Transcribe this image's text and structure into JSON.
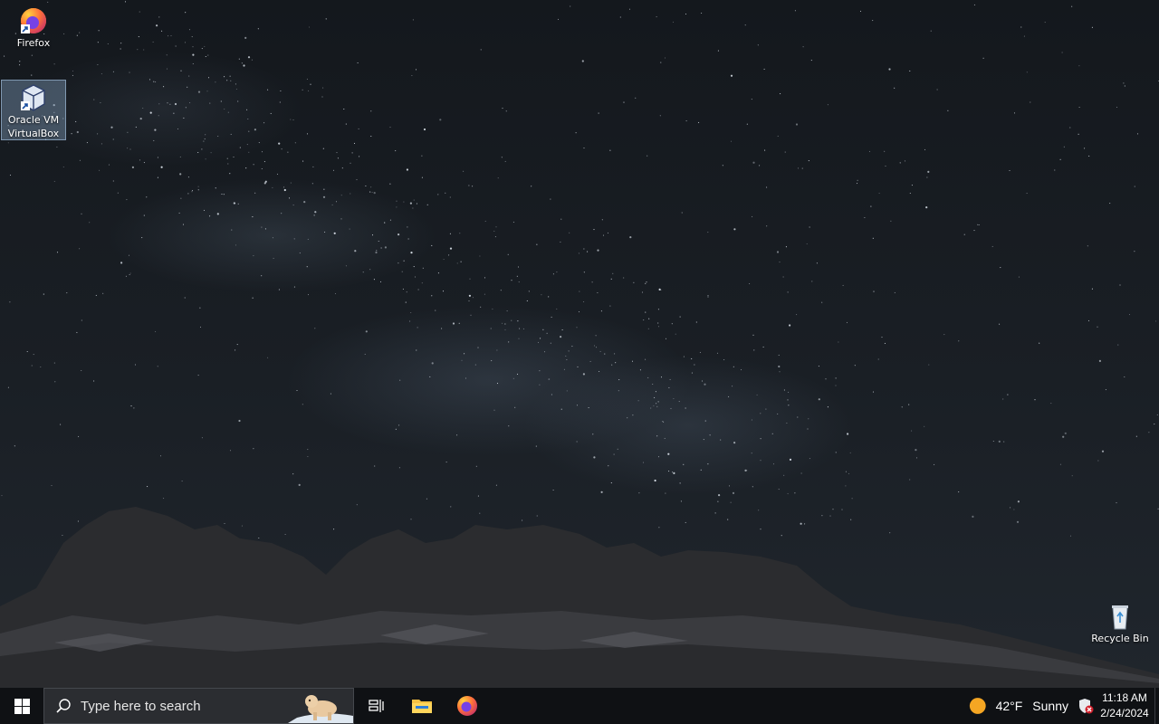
{
  "desktop": {
    "icons": [
      {
        "label": "Firefox"
      },
      {
        "label": "Oracle VM VirtualBox"
      },
      {
        "label": "Recycle Bin"
      }
    ]
  },
  "taskbar": {
    "start_icon": "windows-logo-icon",
    "search": {
      "placeholder": "Type here to search"
    },
    "pinned": [
      {
        "name": "task-view-icon"
      },
      {
        "name": "file-explorer-icon"
      },
      {
        "name": "firefox-icon"
      }
    ],
    "weather": {
      "temp": "42°F",
      "condition": "Sunny",
      "icon": "sun-icon"
    },
    "tray": {
      "security_icon": "windows-security-alert-icon"
    },
    "clock": {
      "time": "11:18 AM",
      "date": "2/24/2024"
    }
  },
  "colors": {
    "taskbar_bg": "#0f1114",
    "search_bg": "#2b2d31",
    "sun": "#f5a623"
  }
}
